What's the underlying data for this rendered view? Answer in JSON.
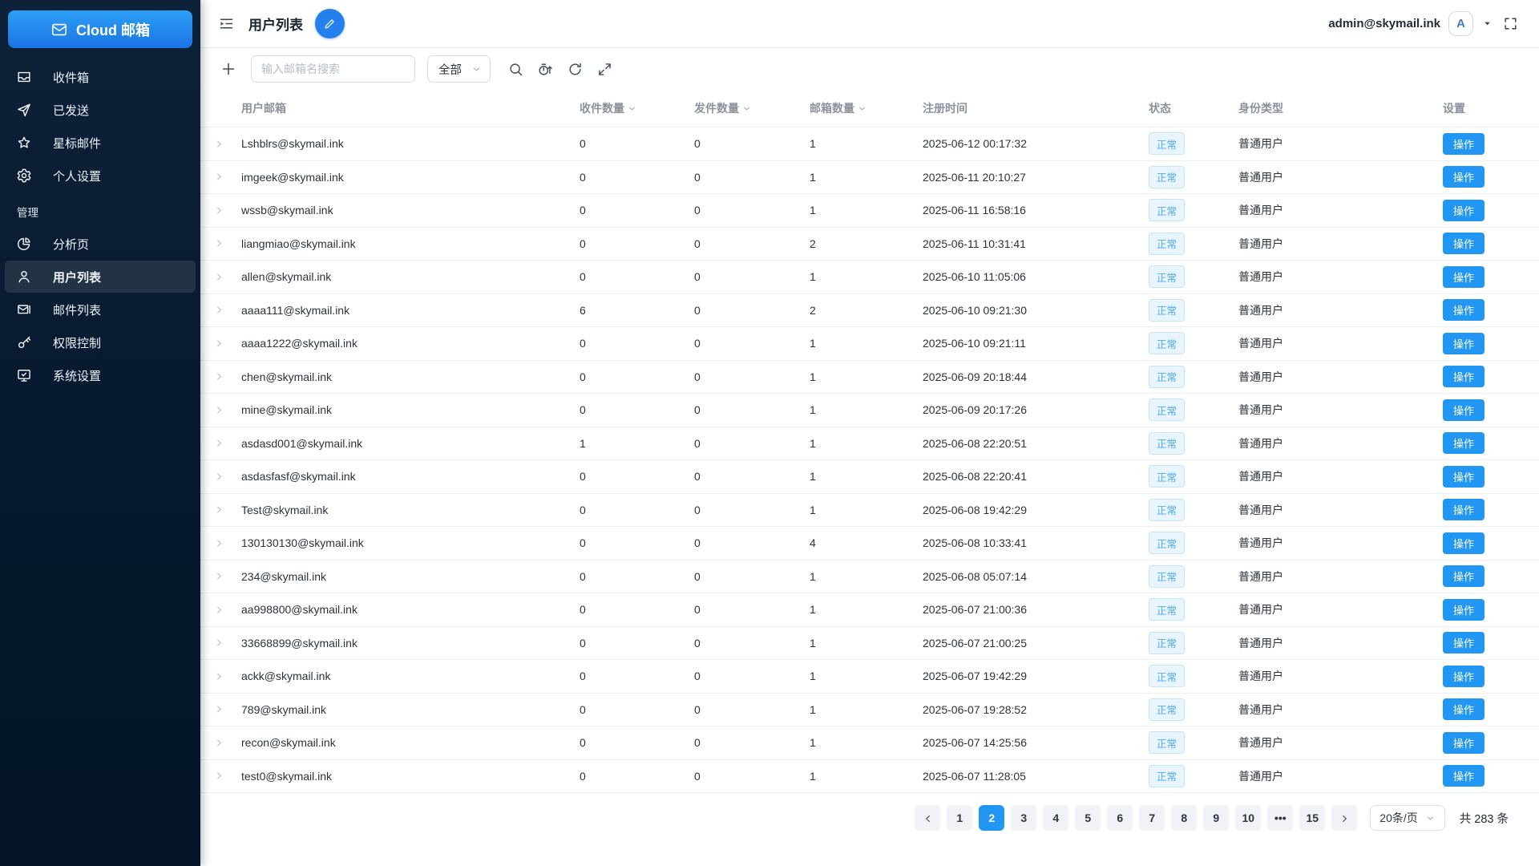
{
  "brand": {
    "name": "Cloud 邮箱",
    "logo_icon": "mail-logo-icon",
    "accent_color": "#2196f3",
    "sidebar_bg": "#0a1c33"
  },
  "sidebar": {
    "main_items": [
      {
        "id": "inbox",
        "icon": "inbox-icon",
        "label": "收件箱",
        "active": false
      },
      {
        "id": "sent",
        "icon": "send-icon",
        "label": "已发送",
        "active": false
      },
      {
        "id": "starred",
        "icon": "star-icon",
        "label": "星标邮件",
        "active": false
      },
      {
        "id": "personal-settings",
        "icon": "gear-icon",
        "label": "个人设置",
        "active": false
      }
    ],
    "section_label": "管理",
    "admin_items": [
      {
        "id": "analytics",
        "icon": "pie-icon",
        "label": "分析页",
        "active": false
      },
      {
        "id": "user-list",
        "icon": "user-icon",
        "label": "用户列表",
        "active": true
      },
      {
        "id": "mail-list",
        "icon": "mail-list-icon",
        "label": "邮件列表",
        "active": false
      },
      {
        "id": "permissions",
        "icon": "key-icon",
        "label": "权限控制",
        "active": false
      },
      {
        "id": "system-settings",
        "icon": "monitor-icon",
        "label": "系统设置",
        "active": false
      }
    ]
  },
  "header": {
    "title": "用户列表",
    "icons": [
      "menu-fold-icon",
      "edit-pencil-icon",
      "caret-down-icon",
      "fullscreen-icon"
    ],
    "user_email": "admin@skymail.ink",
    "avatar_letter": "A"
  },
  "toolbar": {
    "add_icon": "plus-icon",
    "search_placeholder": "输入邮箱名搜索",
    "filter_value": "全部",
    "icons": [
      "search-icon",
      "timer-sort-icon",
      "refresh-icon",
      "expand-icon"
    ]
  },
  "table": {
    "columns": [
      {
        "label": "用户邮箱",
        "sortable": false
      },
      {
        "label": "收件数量",
        "sortable": true
      },
      {
        "label": "发件数量",
        "sortable": true
      },
      {
        "label": "邮箱数量",
        "sortable": true
      },
      {
        "label": "注册时间",
        "sortable": false
      },
      {
        "label": "状态",
        "sortable": false
      },
      {
        "label": "身份类型",
        "sortable": false
      },
      {
        "label": "设置",
        "sortable": false
      }
    ],
    "status_colors": {
      "bg": "#e9f5fe",
      "border": "#c3e4fb",
      "text": "#4aa9f3"
    },
    "rows": [
      {
        "email": "Lshblrs@skymail.ink",
        "inbox_count": 0,
        "sent_count": 0,
        "mailbox_count": 1,
        "registered_at": "2025-06-12 00:17:32",
        "status": "正常",
        "identity": "普通用户",
        "action": "操作"
      },
      {
        "email": "imgeek@skymail.ink",
        "inbox_count": 0,
        "sent_count": 0,
        "mailbox_count": 1,
        "registered_at": "2025-06-11 20:10:27",
        "status": "正常",
        "identity": "普通用户",
        "action": "操作"
      },
      {
        "email": "wssb@skymail.ink",
        "inbox_count": 0,
        "sent_count": 0,
        "mailbox_count": 1,
        "registered_at": "2025-06-11 16:58:16",
        "status": "正常",
        "identity": "普通用户",
        "action": "操作"
      },
      {
        "email": "liangmiao@skymail.ink",
        "inbox_count": 0,
        "sent_count": 0,
        "mailbox_count": 2,
        "registered_at": "2025-06-11 10:31:41",
        "status": "正常",
        "identity": "普通用户",
        "action": "操作"
      },
      {
        "email": "allen@skymail.ink",
        "inbox_count": 0,
        "sent_count": 0,
        "mailbox_count": 1,
        "registered_at": "2025-06-10 11:05:06",
        "status": "正常",
        "identity": "普通用户",
        "action": "操作"
      },
      {
        "email": "aaaa111@skymail.ink",
        "inbox_count": 6,
        "sent_count": 0,
        "mailbox_count": 2,
        "registered_at": "2025-06-10 09:21:30",
        "status": "正常",
        "identity": "普通用户",
        "action": "操作"
      },
      {
        "email": "aaaa1222@skymail.ink",
        "inbox_count": 0,
        "sent_count": 0,
        "mailbox_count": 1,
        "registered_at": "2025-06-10 09:21:11",
        "status": "正常",
        "identity": "普通用户",
        "action": "操作"
      },
      {
        "email": "chen@skymail.ink",
        "inbox_count": 0,
        "sent_count": 0,
        "mailbox_count": 1,
        "registered_at": "2025-06-09 20:18:44",
        "status": "正常",
        "identity": "普通用户",
        "action": "操作"
      },
      {
        "email": "mine@skymail.ink",
        "inbox_count": 0,
        "sent_count": 0,
        "mailbox_count": 1,
        "registered_at": "2025-06-09 20:17:26",
        "status": "正常",
        "identity": "普通用户",
        "action": "操作"
      },
      {
        "email": "asdasd001@skymail.ink",
        "inbox_count": 1,
        "sent_count": 0,
        "mailbox_count": 1,
        "registered_at": "2025-06-08 22:20:51",
        "status": "正常",
        "identity": "普通用户",
        "action": "操作"
      },
      {
        "email": "asdasfasf@skymail.ink",
        "inbox_count": 0,
        "sent_count": 0,
        "mailbox_count": 1,
        "registered_at": "2025-06-08 22:20:41",
        "status": "正常",
        "identity": "普通用户",
        "action": "操作"
      },
      {
        "email": "Test@skymail.ink",
        "inbox_count": 0,
        "sent_count": 0,
        "mailbox_count": 1,
        "registered_at": "2025-06-08 19:42:29",
        "status": "正常",
        "identity": "普通用户",
        "action": "操作"
      },
      {
        "email": "130130130@skymail.ink",
        "inbox_count": 0,
        "sent_count": 0,
        "mailbox_count": 4,
        "registered_at": "2025-06-08 10:33:41",
        "status": "正常",
        "identity": "普通用户",
        "action": "操作"
      },
      {
        "email": "234@skymail.ink",
        "inbox_count": 0,
        "sent_count": 0,
        "mailbox_count": 1,
        "registered_at": "2025-06-08 05:07:14",
        "status": "正常",
        "identity": "普通用户",
        "action": "操作"
      },
      {
        "email": "aa998800@skymail.ink",
        "inbox_count": 0,
        "sent_count": 0,
        "mailbox_count": 1,
        "registered_at": "2025-06-07 21:00:36",
        "status": "正常",
        "identity": "普通用户",
        "action": "操作"
      },
      {
        "email": "33668899@skymail.ink",
        "inbox_count": 0,
        "sent_count": 0,
        "mailbox_count": 1,
        "registered_at": "2025-06-07 21:00:25",
        "status": "正常",
        "identity": "普通用户",
        "action": "操作"
      },
      {
        "email": "ackk@skymail.ink",
        "inbox_count": 0,
        "sent_count": 0,
        "mailbox_count": 1,
        "registered_at": "2025-06-07 19:42:29",
        "status": "正常",
        "identity": "普通用户",
        "action": "操作"
      },
      {
        "email": "789@skymail.ink",
        "inbox_count": 0,
        "sent_count": 0,
        "mailbox_count": 1,
        "registered_at": "2025-06-07 19:28:52",
        "status": "正常",
        "identity": "普通用户",
        "action": "操作"
      },
      {
        "email": "recon@skymail.ink",
        "inbox_count": 0,
        "sent_count": 0,
        "mailbox_count": 1,
        "registered_at": "2025-06-07 14:25:56",
        "status": "正常",
        "identity": "普通用户",
        "action": "操作"
      },
      {
        "email": "test0@skymail.ink",
        "inbox_count": 0,
        "sent_count": 0,
        "mailbox_count": 1,
        "registered_at": "2025-06-07 11:28:05",
        "status": "正常",
        "identity": "普通用户",
        "action": "操作"
      }
    ]
  },
  "pagination": {
    "pages": [
      "1",
      "2",
      "3",
      "4",
      "5",
      "6",
      "7",
      "8",
      "9",
      "10",
      "ellipsis",
      "15"
    ],
    "active_page": "2",
    "ellipsis_label": "•••",
    "page_size_label": "20条/页",
    "total_label": "共 283 条",
    "active_color": "#2196f3"
  }
}
